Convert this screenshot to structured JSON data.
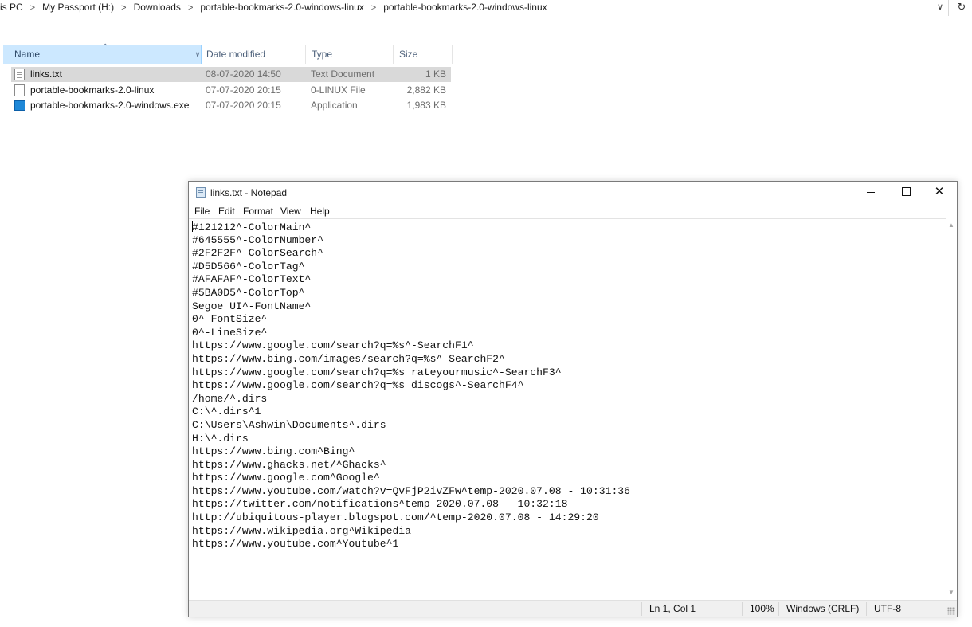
{
  "explorer": {
    "breadcrumbs": [
      "is PC",
      "My Passport (H:)",
      "Downloads",
      "portable-bookmarks-2.0-windows-linux",
      "portable-bookmarks-2.0-windows-linux"
    ],
    "breadcrumb_separator": ">",
    "columns": {
      "name": "Name",
      "date": "Date modified",
      "type": "Type",
      "size": "Size"
    },
    "files": [
      {
        "name": "links.txt",
        "date": "08-07-2020 14:50",
        "type": "Text Document",
        "size": "1 KB",
        "icon": "text-file-icon",
        "selected": true
      },
      {
        "name": "portable-bookmarks-2.0-linux",
        "date": "07-07-2020 20:15",
        "type": "0-LINUX File",
        "size": "2,882 KB",
        "icon": "file-icon",
        "selected": false
      },
      {
        "name": "portable-bookmarks-2.0-windows.exe",
        "date": "07-07-2020 20:15",
        "type": "Application",
        "size": "1,983 KB",
        "icon": "application-icon",
        "selected": false
      }
    ],
    "selection_color": "#d9d9d9",
    "header_highlight_color": "#cce8ff"
  },
  "notepad": {
    "title": "links.txt - Notepad",
    "menu": [
      "File",
      "Edit",
      "Format",
      "View",
      "Help"
    ],
    "lines": [
      "#121212^-ColorMain^",
      "#645555^-ColorNumber^",
      "#2F2F2F^-ColorSearch^",
      "#D5D566^-ColorTag^",
      "#AFAFAF^-ColorText^",
      "#5BA0D5^-ColorTop^",
      "Segoe UI^-FontName^",
      "0^-FontSize^",
      "0^-LineSize^",
      "https://www.google.com/search?q=%s^-SearchF1^",
      "https://www.bing.com/images/search?q=%s^-SearchF2^",
      "https://www.google.com/search?q=%s rateyourmusic^-SearchF3^",
      "https://www.google.com/search?q=%s discogs^-SearchF4^",
      "/home/^.dirs",
      "C:\\^.dirs^1",
      "C:\\Users\\Ashwin\\Documents^.dirs",
      "H:\\^.dirs",
      "https://www.bing.com^Bing^",
      "https://www.ghacks.net/^Ghacks^",
      "https://www.google.com^Google^",
      "https://www.youtube.com/watch?v=QvFjP2ivZFw^temp-2020.07.08 - 10:31:36",
      "https://twitter.com/notifications^temp-2020.07.08 - 10:32:18",
      "http://ubiquitous-player.blogspot.com/^temp-2020.07.08 - 14:29:20",
      "https://www.wikipedia.org^Wikipedia",
      "https://www.youtube.com^Youtube^1"
    ],
    "status": {
      "position": "Ln 1, Col 1",
      "zoom": "100%",
      "line_ending": "Windows (CRLF)",
      "encoding": "UTF-8"
    }
  }
}
